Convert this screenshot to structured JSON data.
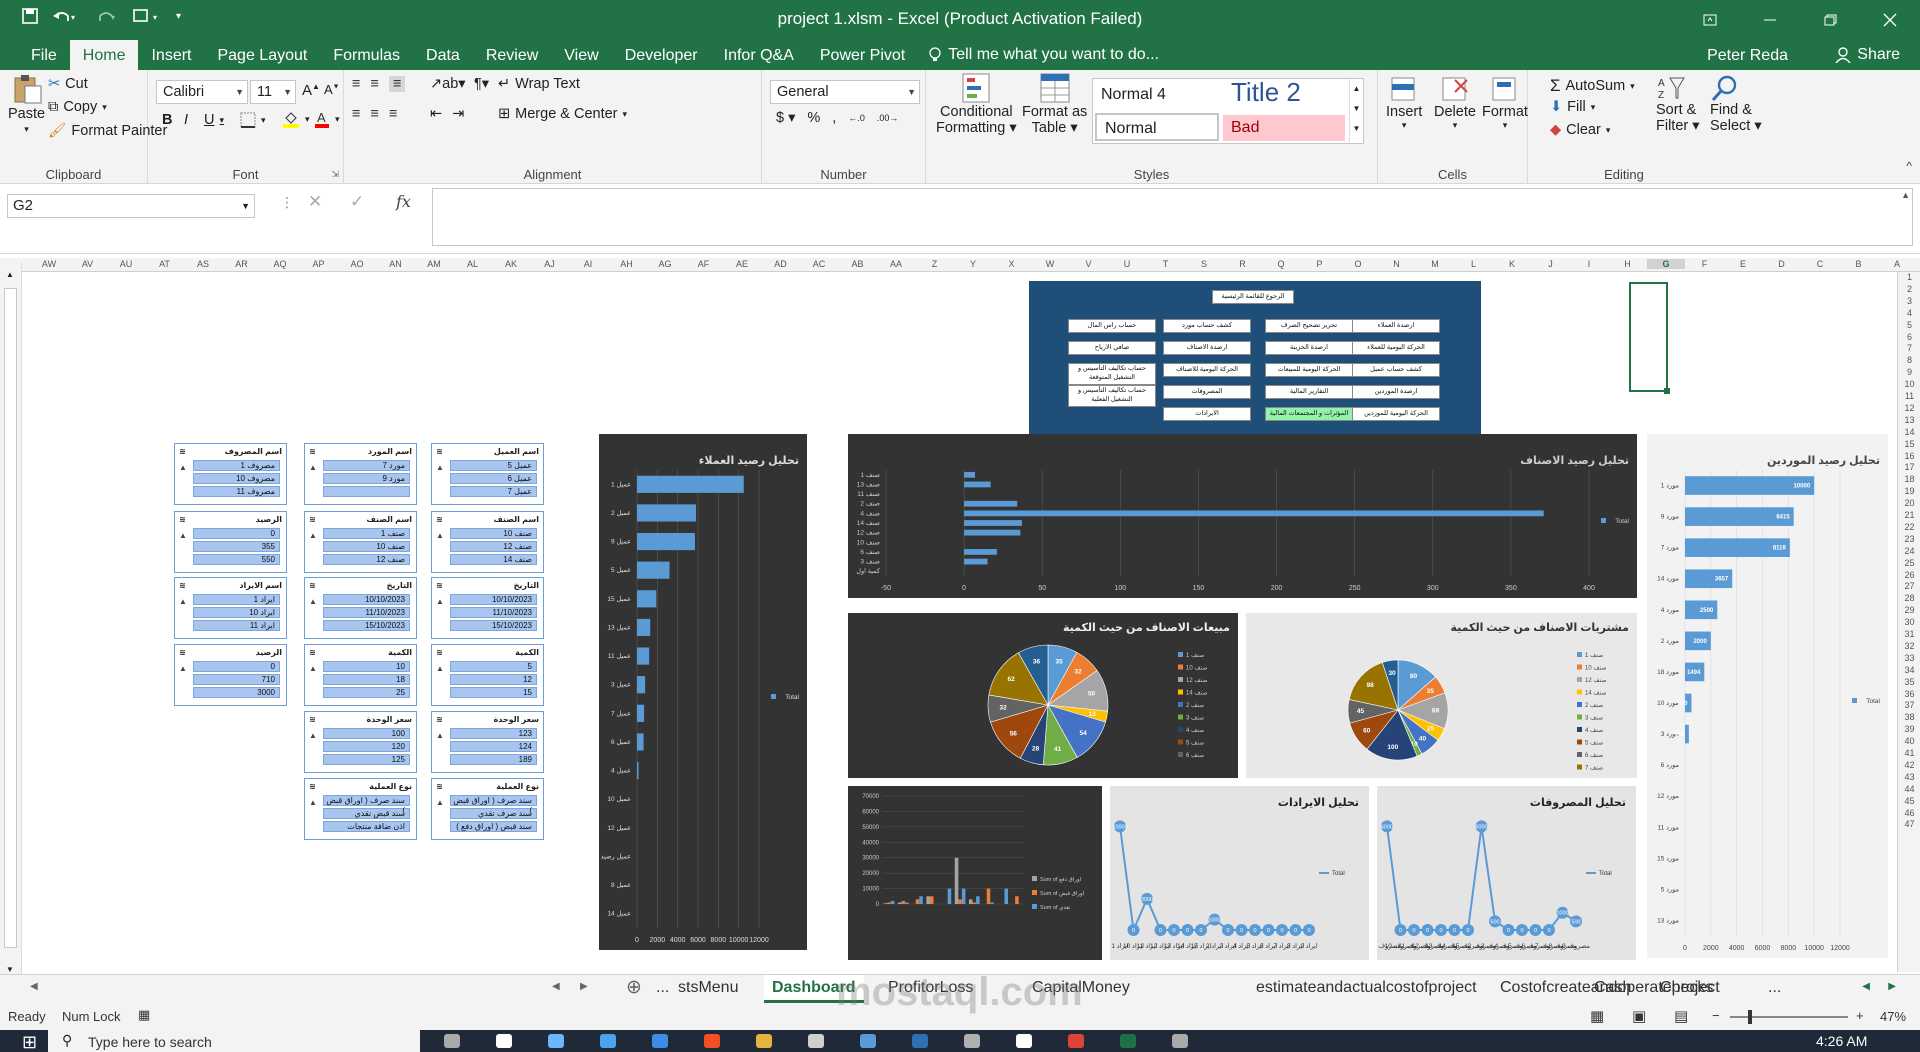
{
  "window": {
    "title": "project 1.xlsm - Excel (Product Activation Failed)"
  },
  "menu_tabs": [
    "File",
    "Home",
    "Insert",
    "Page Layout",
    "Formulas",
    "Data",
    "Review",
    "View",
    "Developer",
    "Infor Q&A",
    "Power Pivot"
  ],
  "active_tab": "Home",
  "tell_me": "Tell me what you want to do...",
  "user": "Peter Reda",
  "share": "Share",
  "ribbon": {
    "clipboard": {
      "paste": "Paste",
      "cut": "Cut",
      "copy": "Copy",
      "format_painter": "Format Painter",
      "label": "Clipboard"
    },
    "font": {
      "name": "Calibri",
      "size": "11",
      "label": "Font"
    },
    "alignment": {
      "wrap": "Wrap Text",
      "merge": "Merge & Center",
      "label": "Alignment"
    },
    "number": {
      "format": "General",
      "label": "Number"
    },
    "styles": {
      "conditional": "Conditional",
      "conditional2": "Formatting",
      "format_as": "Format as",
      "format_as2": "Table",
      "normal4": "Normal 4",
      "title2": "Title 2",
      "normal": "Normal",
      "bad": "Bad",
      "label": "Styles"
    },
    "cells": {
      "insert": "Insert",
      "delete": "Delete",
      "format": "Format",
      "label": "Cells"
    },
    "editing": {
      "autosum": "AutoSum",
      "fill": "Fill",
      "clear": "Clear",
      "sort": "Sort &",
      "sort2": "Filter",
      "find": "Find &",
      "find2": "Select",
      "label": "Editing"
    }
  },
  "name_box": "G2",
  "columns": [
    "AW",
    "AV",
    "AU",
    "AT",
    "AS",
    "AR",
    "AQ",
    "AP",
    "AO",
    "AN",
    "AM",
    "AL",
    "AK",
    "AJ",
    "AI",
    "AH",
    "AG",
    "AF",
    "AE",
    "AD",
    "AC",
    "AB",
    "AA",
    "Z",
    "Y",
    "X",
    "W",
    "V",
    "U",
    "T",
    "S",
    "R",
    "Q",
    "P",
    "O",
    "N",
    "M",
    "L",
    "K",
    "J",
    "I",
    "H",
    "G",
    "F",
    "E",
    "D",
    "C",
    "B",
    "A"
  ],
  "selected_column": "G",
  "rows": [
    "1",
    "2",
    "3",
    "4",
    "5",
    "6",
    "7",
    "8",
    "9",
    "10",
    "11",
    "12",
    "13",
    "14",
    "15",
    "16",
    "17",
    "18",
    "19",
    "20",
    "21",
    "22",
    "23",
    "24",
    "25",
    "26",
    "27",
    "28",
    "29",
    "30",
    "31",
    "32",
    "33",
    "34",
    "35",
    "36",
    "37",
    "38",
    "39",
    "40",
    "41",
    "42",
    "43",
    "44",
    "45",
    "46",
    "47"
  ],
  "sheet_tabs": [
    "...",
    "stsMenu",
    "Dashboard",
    "ProfitorLoss",
    "CapitalMoney",
    "estimateandactualcostofproject",
    "Costofcreateandoperateproject",
    "Cash",
    "Checks",
    "..."
  ],
  "active_sheet": "Dashboard",
  "status": {
    "ready": "Ready",
    "numlock": "Num Lock",
    "zoom": "47%"
  },
  "taskbar": {
    "search": "Type here to search",
    "time": "4:26 AM"
  },
  "watermark": "mostaql.com",
  "menu_panel": {
    "top": "الرجوع للقائمة الرئيسية",
    "buttons": [
      [
        "ارصدة العملاء",
        "كشف حساب مورد",
        "تحرير تصحيح الصرف",
        "حساب راس المال"
      ],
      [
        "الحركة اليومية للعملاء",
        "ارصدة الاصناف",
        "ارصدة الخزينة",
        "صافي الارباح"
      ],
      [
        "كشف حساب عميل",
        "الحركة اليومية للاصناف",
        "الحركة اليومية للمبيعات",
        "حساب تكاليف التأسيس و التشغيل المتوقعة"
      ],
      [
        "ارصدة الموردين",
        "المصروفات",
        "التقارير المالية",
        "حساب تكاليف التأسيس و التشغيل الفعلية"
      ],
      [
        "الحركة اليومية للموردين",
        "الايرادات",
        "المؤثرات و المجتمعات المالية",
        ""
      ]
    ]
  },
  "slicers": [
    {
      "title": "اسم العميل",
      "items": [
        "عميل 5",
        "عميل 6",
        "عميل 7"
      ]
    },
    {
      "title": "اسم المورد",
      "items": [
        "مورد 7",
        "مورد 9",
        ""
      ]
    },
    {
      "title": "اسم المصروف",
      "items": [
        "مصروف 1",
        "مصروف 10",
        "مصروف 11"
      ]
    },
    {
      "title": "اسم الصنف",
      "items": [
        "صنف 10",
        "صنف 12",
        "صنف 14"
      ]
    },
    {
      "title": "اسم الصنف",
      "items": [
        "صنف 1",
        "صنف 10",
        "صنف 12"
      ]
    },
    {
      "title": "الرصيد",
      "items": [
        "0",
        "355",
        "550"
      ]
    },
    {
      "title": "التاريخ",
      "items": [
        "10/10/2023",
        "11/10/2023",
        "15/10/2023"
      ]
    },
    {
      "title": "التاريخ",
      "items": [
        "10/10/2023",
        "11/10/2023",
        "15/10/2023"
      ]
    },
    {
      "title": "اسم الايراد",
      "items": [
        "ايراد 1",
        "ايراد 10",
        "ايراد 11"
      ]
    },
    {
      "title": "الكمية",
      "items": [
        "5",
        "12",
        "15"
      ]
    },
    {
      "title": "الكمية",
      "items": [
        "10",
        "18",
        "25"
      ]
    },
    {
      "title": "الرصيد",
      "items": [
        "0",
        "710",
        "3000"
      ]
    },
    {
      "title": "سعر الوحدة",
      "items": [
        "123",
        "124",
        "189"
      ]
    },
    {
      "title": "سعر الوحدة",
      "items": [
        "100",
        "120",
        "125"
      ]
    },
    {
      "title": "نوع العملية",
      "items": [
        "سند صرف ( اوراق قبض )",
        "سند صرف نقدي",
        "سند قبض ( اوراق دفع )"
      ]
    },
    {
      "title": "نوع العملية",
      "items": [
        "سند صرف ( اوراق قبض )",
        "سند قبض نقدي",
        "اذن ضافة منتجات"
      ]
    }
  ],
  "chart_data": [
    {
      "type": "bar",
      "title": "تحليل رصيد العملاء",
      "categories": [
        "عميل 1",
        "عميل 2",
        "عميل 9",
        "عميل 5",
        "عميل 15",
        "عميل 13",
        "عميل 11",
        "عميل 3",
        "عميل 7",
        "عميل 6",
        "عميل 4",
        "عميل 10",
        "عميل 12",
        "عميل رصيد",
        "عميل 8",
        "عميل 14"
      ],
      "values": [
        10500,
        5800,
        5700,
        3200,
        1900,
        1300,
        1200,
        800,
        700,
        650,
        150,
        0,
        0,
        0,
        0,
        0
      ],
      "xticks": [
        "0",
        "2000",
        "4000",
        "6000",
        "8000",
        "10000",
        "12000"
      ],
      "xlim": [
        0,
        12000
      ],
      "legend": "Total"
    },
    {
      "type": "bar",
      "title": "تحليل رصيد الاصناف",
      "categories": [
        "صنف 1",
        "صنف 13",
        "صنف 11",
        "صنف 2",
        "صنف 4",
        "صنف 14",
        "صنف 12",
        "صنف 10",
        "صنف 6",
        "صنف 3",
        "كمية اول"
      ],
      "values": [
        7,
        17,
        0,
        34,
        371,
        37,
        36,
        0,
        21,
        15,
        0
      ],
      "xticks": [
        "-50",
        "0",
        "50",
        "100",
        "150",
        "200",
        "250",
        "300",
        "350",
        "400"
      ],
      "xlim": [
        -50,
        400
      ],
      "legend": "Total"
    },
    {
      "type": "bar",
      "title": "تحليل رصيد الموردين",
      "categories": [
        "مورد 1",
        "مورد 9",
        "مورد 7",
        "مورد 14",
        "مورد 4",
        "مورد 2",
        "مورد 18",
        "مورد 10",
        "مورد 3",
        "مورد 6",
        "مورد 12",
        "مورد 11",
        "مورد 15",
        "مورد 5",
        "مورد 13"
      ],
      "values": [
        10000,
        8415,
        8119,
        3657,
        2500,
        2000,
        1494,
        500,
        300,
        0,
        0,
        0,
        0,
        0,
        0
      ],
      "xticks": [
        "0",
        "2000",
        "4000",
        "6000",
        "8000",
        "10000",
        "12000"
      ],
      "xlim": [
        0,
        12000
      ],
      "legend": "Total"
    },
    {
      "type": "pie",
      "title": "مبيعات الاصناف من حيث الكمية",
      "labels": [
        "صنف 1",
        "صنف 10",
        "صنف 12",
        "صنف 14",
        "صنف 2",
        "صنف 3",
        "صنف 4",
        "صنف 5",
        "صنف 6"
      ],
      "values": [
        35,
        32,
        50,
        13,
        54,
        41,
        28,
        56,
        32,
        62,
        36
      ],
      "colors": [
        "#5b9bd5",
        "#ed7d31",
        "#a5a5a5",
        "#ffc000",
        "#4472c4",
        "#70ad47",
        "#264478",
        "#9e480e",
        "#636363",
        "#997300",
        "#255e91"
      ]
    },
    {
      "type": "pie",
      "title": "مشتريات الاصناف من حيث الكمية",
      "labels": [
        "صنف 1",
        "صنف 10",
        "صنف 12",
        "صنف 14",
        "صنف 2",
        "صنف 3",
        "صنف 4",
        "صنف 5",
        "صنف 6",
        "صنف 7"
      ],
      "values": [
        80,
        35,
        69,
        25,
        40,
        10,
        100,
        60,
        45,
        98,
        30
      ],
      "colors": [
        "#5b9bd5",
        "#ed7d31",
        "#a5a5a5",
        "#ffc000",
        "#4472c4",
        "#70ad47",
        "#264478",
        "#9e480e",
        "#636363",
        "#997300",
        "#255e91"
      ]
    },
    {
      "type": "bar",
      "title": "",
      "series": [
        {
          "name": "Sum of اوراق دفع",
          "values": [
            500,
            1000,
            0,
            5000,
            0,
            30000,
            3000,
            0,
            0,
            0
          ]
        },
        {
          "name": "Sum of اوراق قبض",
          "values": [
            1000,
            2000,
            3000,
            5000,
            0,
            3000,
            1000,
            10000,
            0,
            5000
          ]
        },
        {
          "name": "Sum of نقدي",
          "values": [
            2000,
            1000,
            5000,
            0,
            10000,
            10000,
            5000,
            1000,
            10000,
            0
          ]
        }
      ],
      "yticks": [
        "0",
        "10000",
        "20000",
        "30000",
        "40000",
        "50000",
        "60000",
        "70000"
      ],
      "ylim": [
        0,
        70000
      ]
    },
    {
      "type": "line",
      "title": "تحليل الايرادات",
      "x": [
        "ايراد 1",
        "ايراد 10",
        "ايراد 11",
        "ايراد 12",
        "ايراد 13",
        "ايراد 14",
        "ايراد 15",
        "ايراد 2",
        "ايراد 3",
        "ايراد 4",
        "ايراد 5",
        "ايراد 6",
        "ايراد 7",
        "ايراد 8",
        "ايراد 9"
      ],
      "values": [
        10000,
        0,
        3000,
        0,
        0,
        0,
        0,
        1000,
        0,
        0,
        0,
        0,
        0,
        0,
        0
      ],
      "legend": "Total"
    },
    {
      "type": "line",
      "title": "تحليل المصروفات",
      "x": [
        "مصروف 1",
        "مصروف 10",
        "مصروف 11",
        "مصروف 12",
        "مصروف 13",
        "مصروف 14",
        "مصروف 15",
        "مصروف 2",
        "مصروف 3",
        "مصروف 4",
        "مصروف 5",
        "مصروف 6",
        "مصروف 7",
        "مصروف 8",
        "مصروف 9"
      ],
      "values": [
        6000,
        0,
        0,
        0,
        0,
        0,
        0,
        6000,
        500,
        0,
        0,
        0,
        0,
        1000,
        500
      ],
      "legend": "Total"
    }
  ]
}
